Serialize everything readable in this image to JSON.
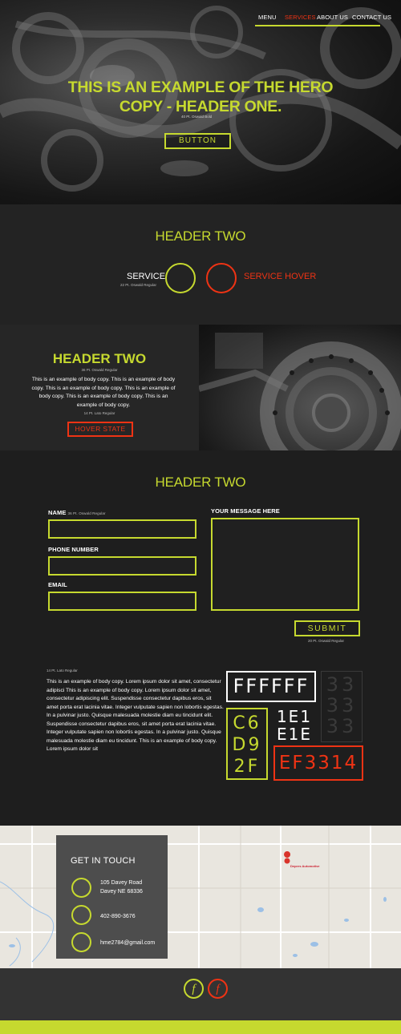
{
  "nav": {
    "items": [
      {
        "label": "MENU",
        "active": false
      },
      {
        "label": "SERVICES",
        "active": true
      },
      {
        "label": "ABOUT US",
        "active": false
      },
      {
        "label": "CONTACT US",
        "active": false
      }
    ]
  },
  "hero": {
    "title_line1": "THIS IS AN EXAMPLE OF THE HERO",
    "title_line2": "COPY - HEADER ONE.",
    "note": "40 Pt. Oswald Bold",
    "button_label": "BUTTON"
  },
  "services": {
    "heading": "HEADER TWO",
    "service_label": "SERVICE",
    "service_note": "22 Pt. Oswald Regular",
    "service_hover_label": "SERVICE HOVER"
  },
  "about": {
    "heading": "HEADER TWO",
    "heading_note": "36 Pt. Oswald Regular",
    "body": "This is an example of body copy. This is an example of body copy. This is an example of body copy. This is an example of body copy. This is an example of body copy. This is an example of body copy.",
    "body_note": "14 Pt. Lato Regular",
    "button_label": "HOVER STATE"
  },
  "form": {
    "heading": "HEADER TWO",
    "name_label": "NAME",
    "name_note": "36 Pt. Oswald Regular",
    "phone_label": "PHONE NUMBER",
    "email_label": "EMAIL",
    "message_label": "YOUR MESSAGE HERE",
    "submit_label": "SUBMIT",
    "submit_note": "20 Pt. Oswald Regular"
  },
  "typography": {
    "note": "14 Pt. Lato Regular",
    "body": "This is an example of body copy. Lorem ipsum dolor sit amet, consectetur adipisci This is an example of body copy. Lorem ipsum dolor sit amet, consectetur adipiscing elit. Suspendisse consectetur dapibus eros, sit amet porta erat lacinia vitae. Integer vulputate sapien non lobortis egestas. In a pulvinar justo. Quisque malesuada molestie diam eu tincidunt elit. Suspendisse consectetur dapibus eros, sit amet porta erat lacinia vitae. Integer vulputate sapien non lobortis egestas. In a pulvinar justo. Quisque malesuada molestie diam eu tincidunt. This is an example of body copy. Lorem ipsum dolor sit"
  },
  "swatches": {
    "white": {
      "label": "FFFFFF",
      "color": "#ffffff"
    },
    "gray": {
      "lines": [
        "33",
        "33",
        "33"
      ],
      "color": "#333333"
    },
    "lime": {
      "lines": [
        "C6",
        "D9",
        "2F"
      ],
      "color": "#c6d92f"
    },
    "dark": {
      "lines": [
        "1E1",
        "E1E"
      ],
      "color": "#1e1e1e"
    },
    "red": {
      "label": "EF3314",
      "color": "#ef3314"
    }
  },
  "contact": {
    "title": "GET IN TOUCH",
    "address_line1": "105 Davey Road",
    "address_line2": "Davey NE 68336",
    "phone": "402-890-3676",
    "email": "hme2784@gmail.com",
    "map_pin_label": "Depers Automotive"
  },
  "footer": {
    "social_1_icon": "facebook-icon",
    "social_2_icon": "facebook-icon",
    "social_glyph": "f"
  },
  "colors": {
    "accent": "#c6d92f",
    "hover": "#ef3314",
    "background": "#1e1e1e"
  }
}
